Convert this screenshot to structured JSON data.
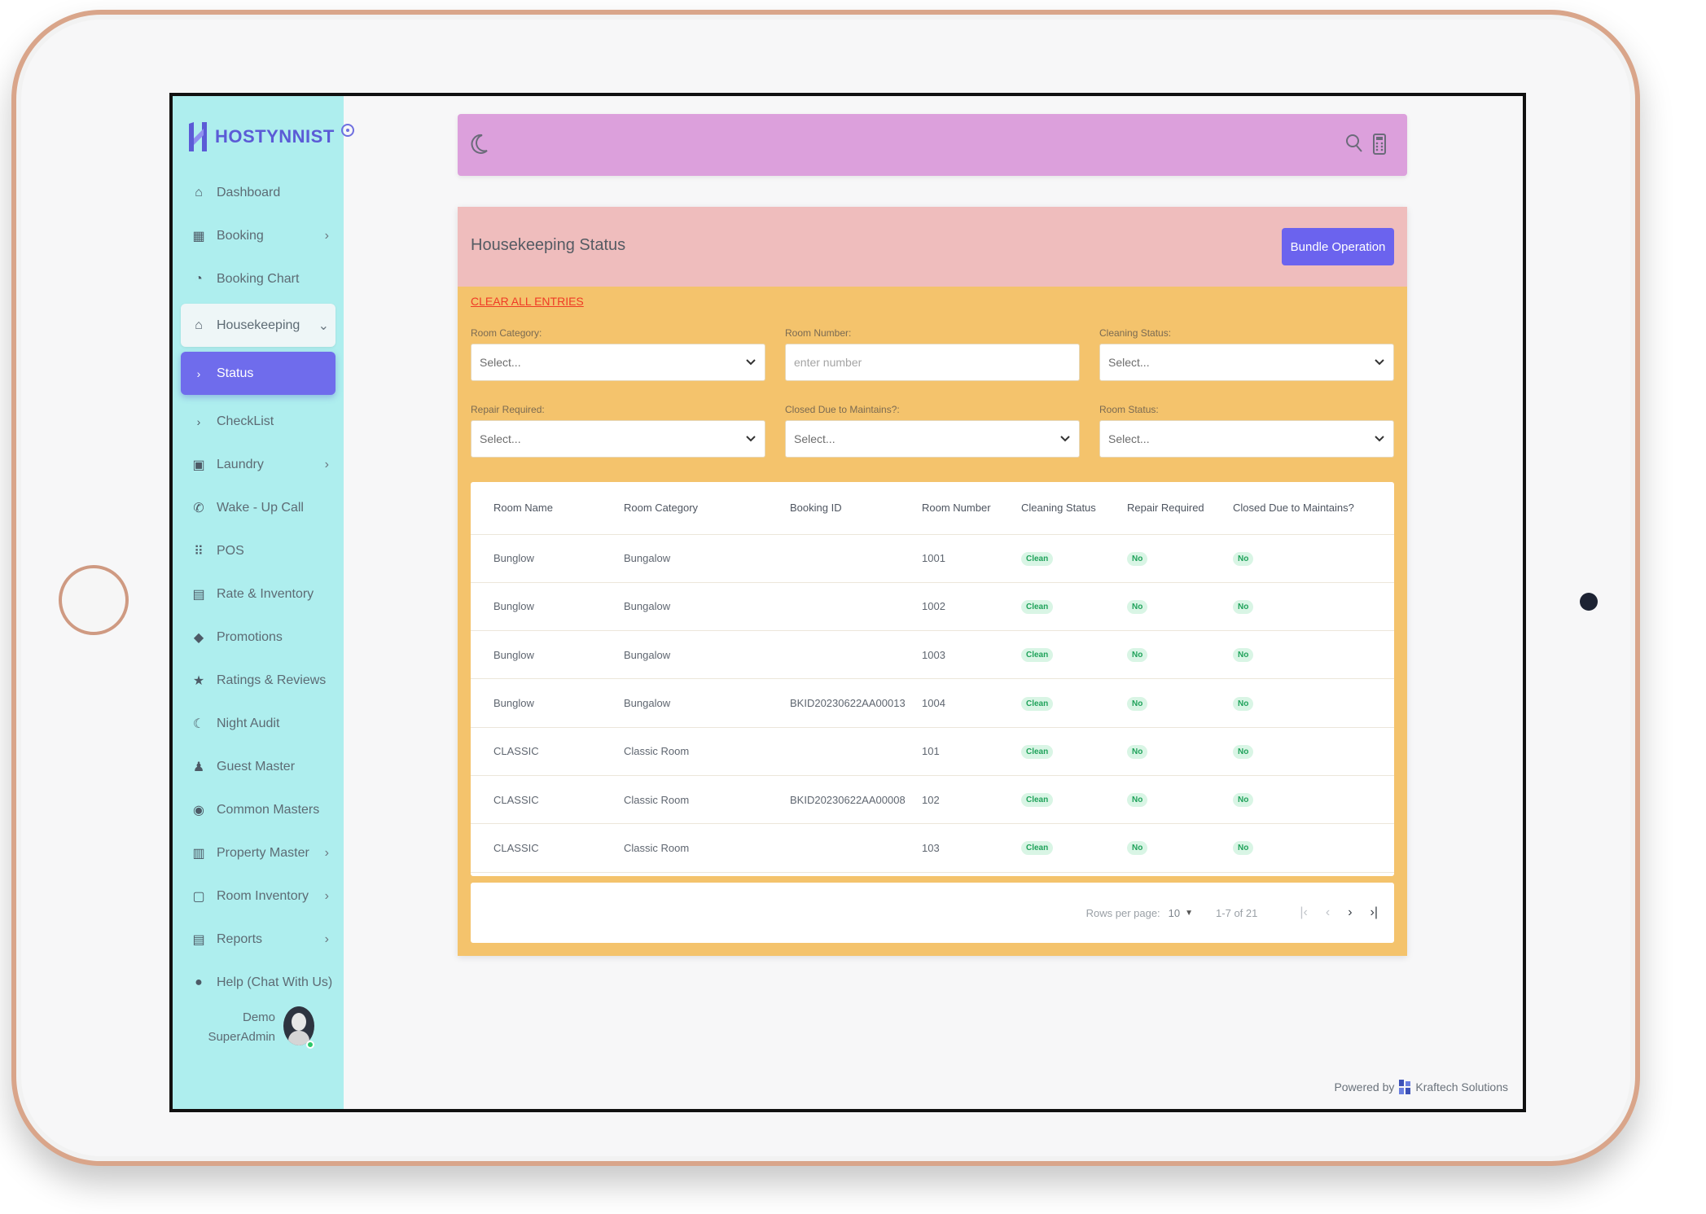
{
  "brand": {
    "name": "HOSTYNNIST"
  },
  "sidebar": {
    "items": [
      {
        "label": "Dashboard",
        "icon": "home-icon",
        "has_arrow": false
      },
      {
        "label": "Booking",
        "icon": "calendar-icon",
        "has_arrow": true
      },
      {
        "label": "Booking Chart",
        "icon": "chart-icon",
        "has_arrow": false
      },
      {
        "label": "Housekeeping",
        "icon": "house-icon",
        "has_arrow": true,
        "open": true
      },
      {
        "label": "Status",
        "icon": "chevron-right-icon",
        "active": true,
        "sub": true
      },
      {
        "label": "CheckList",
        "icon": "chevron-right-icon",
        "sub": true
      },
      {
        "label": "Laundry",
        "icon": "laundry-icon",
        "has_arrow": true
      },
      {
        "label": "Wake - Up Call",
        "icon": "phone-icon",
        "has_arrow": false
      },
      {
        "label": "POS",
        "icon": "grid-icon",
        "has_arrow": false
      },
      {
        "label": "Rate & Inventory",
        "icon": "inventory-icon",
        "has_arrow": false
      },
      {
        "label": "Promotions",
        "icon": "tag-icon",
        "has_arrow": false
      },
      {
        "label": "Ratings & Reviews",
        "icon": "star-icon",
        "has_arrow": false
      },
      {
        "label": "Night Audit",
        "icon": "night-icon",
        "has_arrow": false
      },
      {
        "label": "Guest Master",
        "icon": "person-icon",
        "has_arrow": false
      },
      {
        "label": "Common Masters",
        "icon": "database-icon",
        "has_arrow": false
      },
      {
        "label": "Property Master",
        "icon": "building-icon",
        "has_arrow": true
      },
      {
        "label": "Room Inventory",
        "icon": "clipboard-icon",
        "has_arrow": true
      },
      {
        "label": "Reports",
        "icon": "report-icon",
        "has_arrow": true
      },
      {
        "label": "Help (Chat With Us)",
        "icon": "chat-icon",
        "has_arrow": false
      }
    ],
    "user": {
      "line1": "Demo",
      "line2": "SuperAdmin"
    }
  },
  "card": {
    "title": "Housekeeping Status",
    "bundle_button": "Bundle Operation",
    "clear_link": "CLEAR ALL ENTRIES"
  },
  "filters": {
    "room_category": {
      "label": "Room Category:",
      "value": "Select..."
    },
    "room_number": {
      "label": "Room Number:",
      "placeholder": "enter number"
    },
    "cleaning_status": {
      "label": "Cleaning Status:",
      "value": "Select..."
    },
    "repair_required": {
      "label": "Repair Required:",
      "value": "Select..."
    },
    "closed_due": {
      "label": "Closed Due to Maintains?:",
      "value": "Select..."
    },
    "room_status": {
      "label": "Room Status:",
      "value": "Select..."
    }
  },
  "table": {
    "columns": [
      "Room Name",
      "Room Category",
      "Booking ID",
      "Room Number",
      "Cleaning Status",
      "Repair Required",
      "Closed Due to Maintains?"
    ],
    "rows": [
      [
        "Bunglow",
        "Bungalow",
        "",
        "1001",
        "Clean",
        "No",
        "No"
      ],
      [
        "Bunglow",
        "Bungalow",
        "",
        "1002",
        "Clean",
        "No",
        "No"
      ],
      [
        "Bunglow",
        "Bungalow",
        "",
        "1003",
        "Clean",
        "No",
        "No"
      ],
      [
        "Bunglow",
        "Bungalow",
        "BKID20230622AA00013",
        "1004",
        "Clean",
        "No",
        "No"
      ],
      [
        "CLASSIC",
        "Classic Room",
        "",
        "101",
        "Clean",
        "No",
        "No"
      ],
      [
        "CLASSIC",
        "Classic Room",
        "BKID20230622AA00008",
        "102",
        "Clean",
        "No",
        "No"
      ],
      [
        "CLASSIC",
        "Classic Room",
        "",
        "103",
        "Clean",
        "No",
        "No"
      ]
    ]
  },
  "pager": {
    "rows_label": "Rows per page:",
    "rows_value": "10",
    "range": "1-7 of 21"
  },
  "footer": {
    "powered_by": "Powered by",
    "company": "Kraftech Solutions"
  },
  "colors": {
    "sidebar": "#aeeeee",
    "topbar": "#dca0dc",
    "card": "#f4c36c",
    "card_header": "#efbdbd",
    "accent": "#6b63ee",
    "link": "#ef3b26",
    "badge_text": "#1fa25a"
  }
}
